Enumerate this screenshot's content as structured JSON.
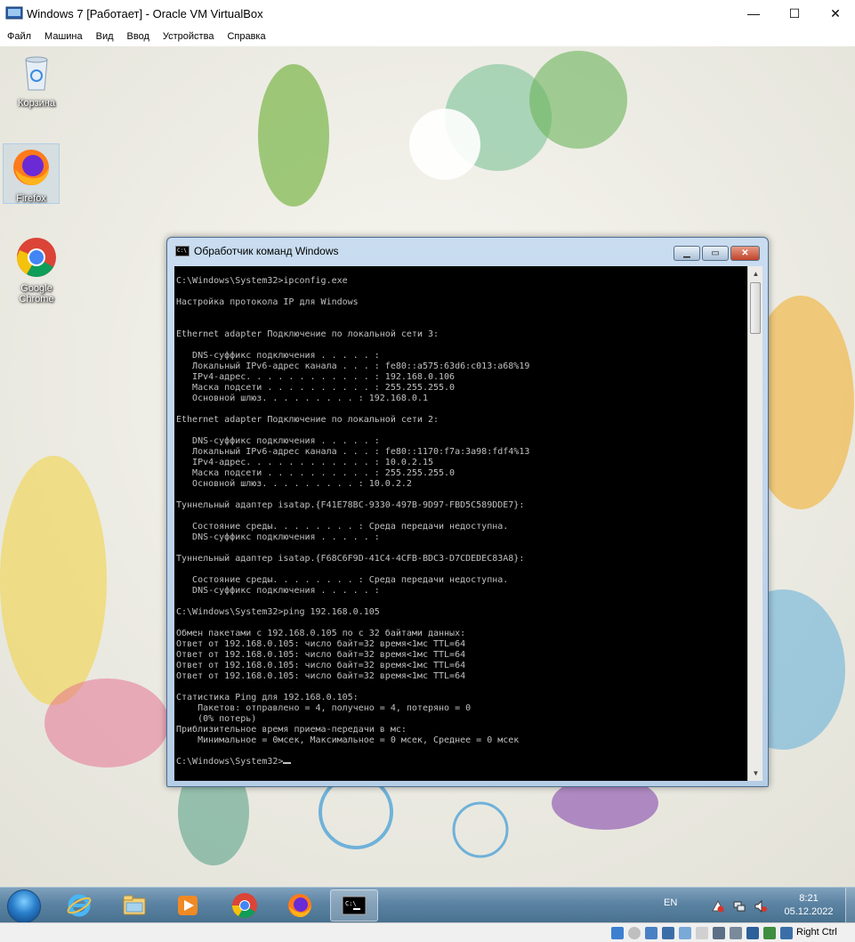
{
  "host_window": {
    "title": "Windows 7 [Работает] - Oracle VM VirtualBox",
    "minimize_glyph": "—",
    "maximize_glyph": "☐",
    "close_glyph": "✕"
  },
  "menu": [
    "Файл",
    "Машина",
    "Вид",
    "Ввод",
    "Устройства",
    "Справка"
  ],
  "desktop_icons": [
    {
      "label": "Корзина",
      "icon": "recycle-bin-icon"
    },
    {
      "label": "Firefox",
      "icon": "firefox-icon"
    },
    {
      "label": "Google Chrome",
      "icon": "chrome-icon"
    }
  ],
  "cmd_window": {
    "title": "Обработчик команд Windows",
    "icon_text": "C:\\",
    "lines": [
      "C:\\Windows\\System32>ipconfig.exe",
      "",
      "Настройка протокола IP для Windows",
      "",
      "",
      "Ethernet adapter Подключение по локальной сети 3:",
      "",
      "   DNS-суффикс подключения . . . . . :",
      "   Локальный IPv6-адрес канала . . . : fe80::a575:63d6:c013:a68%19",
      "   IPv4-адрес. . . . . . . . . . . . : 192.168.0.106",
      "   Маска подсети . . . . . . . . . . : 255.255.255.0",
      "   Основной шлюз. . . . . . . . . : 192.168.0.1",
      "",
      "Ethernet adapter Подключение по локальной сети 2:",
      "",
      "   DNS-суффикс подключения . . . . . :",
      "   Локальный IPv6-адрес канала . . . : fe80::1170:f7a:3a98:fdf4%13",
      "   IPv4-адрес. . . . . . . . . . . . : 10.0.2.15",
      "   Маска подсети . . . . . . . . . . : 255.255.255.0",
      "   Основной шлюз. . . . . . . . . : 10.0.2.2",
      "",
      "Туннельный адаптер isatap.{F41E78BC-9330-497B-9D97-FBD5C589DDE7}:",
      "",
      "   Состояние среды. . . . . . . . : Среда передачи недоступна.",
      "   DNS-суффикс подключения . . . . . :",
      "",
      "Туннельный адаптер isatap.{F68C6F9D-41C4-4CFB-BDC3-D7CDEDEC83A8}:",
      "",
      "   Состояние среды. . . . . . . . : Среда передачи недоступна.",
      "   DNS-суффикс подключения . . . . . :",
      "",
      "C:\\Windows\\System32>ping 192.168.0.105",
      "",
      "Обмен пакетами с 192.168.0.105 по с 32 байтами данных:",
      "Ответ от 192.168.0.105: число байт=32 время<1мс TTL=64",
      "Ответ от 192.168.0.105: число байт=32 время<1мс TTL=64",
      "Ответ от 192.168.0.105: число байт=32 время<1мс TTL=64",
      "Ответ от 192.168.0.105: число байт=32 время<1мс TTL=64",
      "",
      "Статистика Ping для 192.168.0.105:",
      "    Пакетов: отправлено = 4, получено = 4, потеряно = 0",
      "    (0% потерь)",
      "Приблизительное время приема-передачи в мс:",
      "    Минимальное = 0мсек, Максимальное = 0 мсек, Среднее = 0 мсек",
      ""
    ],
    "prompt": "C:\\Windows\\System32>"
  },
  "taskbar": {
    "apps": [
      {
        "name": "internet-explorer-icon",
        "active": false
      },
      {
        "name": "file-explorer-icon",
        "active": false
      },
      {
        "name": "media-player-icon",
        "active": false
      },
      {
        "name": "chrome-icon",
        "active": false
      },
      {
        "name": "firefox-icon",
        "active": false
      },
      {
        "name": "cmd-icon",
        "active": true
      }
    ],
    "language": "EN",
    "time": "8:21",
    "date": "05.12.2022"
  },
  "status_bar": {
    "host_key": "Right Ctrl"
  },
  "colors": {
    "console_bg": "#000000",
    "console_fg": "#c0c0c0",
    "taskbar": "#5c83a3",
    "cmd_frame": "#b6cde6"
  }
}
